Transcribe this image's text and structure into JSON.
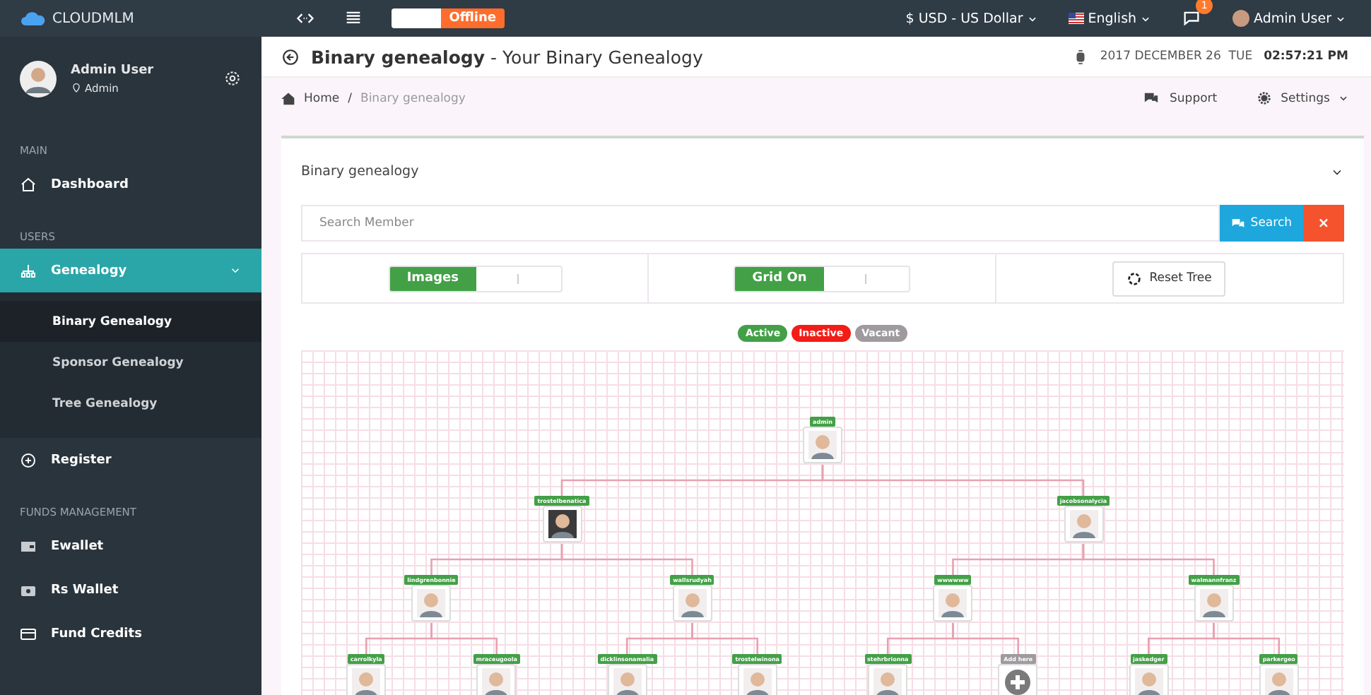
{
  "topbar": {
    "brand": "CLOUDMLM",
    "status_toggle": {
      "label": "Offline",
      "online": false
    },
    "currency": "$ USD - US Dollar",
    "language": "English",
    "messages_badge": "1",
    "user": "Admin User"
  },
  "sidebar": {
    "profile": {
      "name": "Admin User",
      "role": "Admin"
    },
    "sections": [
      {
        "label": "MAIN",
        "items": [
          {
            "kind": "home",
            "label": "Dashboard",
            "selected": false
          }
        ]
      },
      {
        "label": "USERS",
        "items": [
          {
            "kind": "tree",
            "label": "Genealogy",
            "selected": true,
            "expanded": true,
            "children": [
              {
                "label": "Binary Genealogy",
                "selected": true
              },
              {
                "label": "Sponsor Genealogy",
                "selected": false
              },
              {
                "label": "Tree Genealogy",
                "selected": false
              }
            ]
          },
          {
            "kind": "plus",
            "label": "Register",
            "selected": false
          }
        ]
      },
      {
        "label": "FUNDS MANAGEMENT",
        "items": [
          {
            "kind": "wallet",
            "label": "Ewallet",
            "selected": false
          },
          {
            "kind": "safe",
            "label": "Rs Wallet",
            "selected": false
          },
          {
            "kind": "card",
            "label": "Fund Credits",
            "selected": false
          }
        ]
      }
    ]
  },
  "header": {
    "title": "**Binary genealogy** - Your Binary Genealogy",
    "date": "2017 DECEMBER 26  TUE",
    "time": "02:57:21 PM"
  },
  "breadcrumb": {
    "items": [
      "Home",
      "Binary genealogy"
    ],
    "separator": "/",
    "actions": [
      "Support",
      "Settings"
    ]
  },
  "panel": {
    "title": "Binary genealogy",
    "search": {
      "placeholder": "Search Member",
      "button": "Search",
      "clear": "×"
    },
    "toggles": [
      {
        "label": "Images",
        "on": true
      },
      {
        "label": "Grid On",
        "on": true
      }
    ],
    "reset": "Reset Tree",
    "legend": [
      {
        "label": "Active",
        "color": "#43a047"
      },
      {
        "label": "Inactive",
        "color": "#f41c16"
      },
      {
        "label": "Vacant",
        "color": "#9e9a9e"
      }
    ]
  },
  "tree": {
    "name": "admin",
    "kind": "member",
    "children": [
      {
        "name": "trostelbenatica",
        "kind": "member",
        "children": [
          {
            "name": "lindgrenbonnie",
            "kind": "member",
            "children": [
              {
                "name": "carrolkyla",
                "kind": "member"
              },
              {
                "name": "mraceugoola",
                "kind": "member"
              }
            ]
          },
          {
            "name": "wallsrudyah",
            "kind": "member",
            "children": [
              {
                "name": "dicklinsonamalia",
                "kind": "member"
              },
              {
                "name": "trostelwinona",
                "kind": "member"
              }
            ]
          }
        ]
      },
      {
        "name": "jacobsonalycia",
        "kind": "member",
        "children": [
          {
            "name": "wwwwww",
            "kind": "member",
            "children": [
              {
                "name": "stehrbrionna",
                "kind": "member"
              },
              {
                "name": "Add here",
                "kind": "vacant"
              }
            ]
          },
          {
            "name": "walmannfranz",
            "kind": "member",
            "children": [
              {
                "name": "jaskedger",
                "kind": "member"
              },
              {
                "name": "parkergeo",
                "kind": "member"
              }
            ]
          }
        ]
      }
    ]
  }
}
